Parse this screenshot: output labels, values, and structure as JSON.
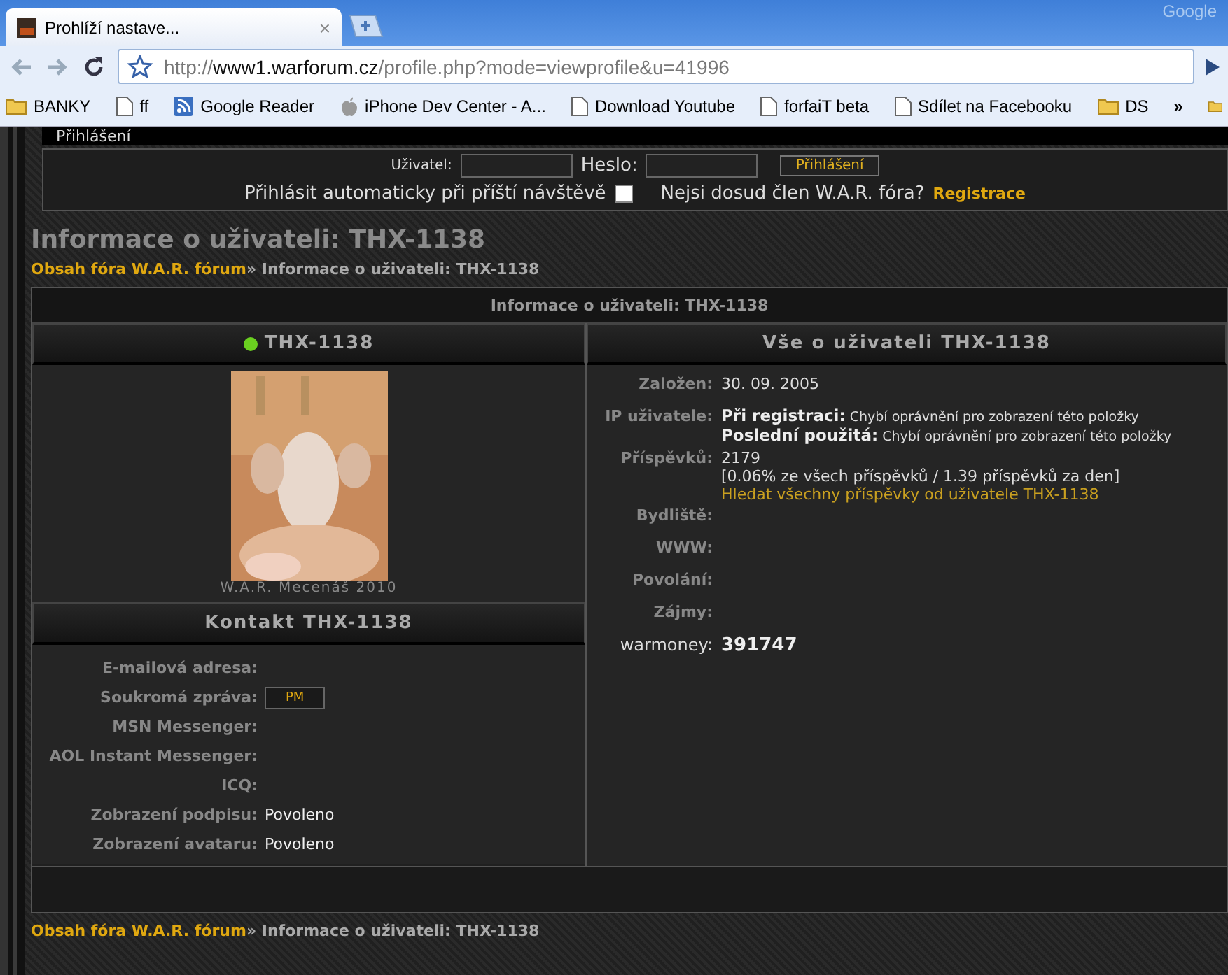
{
  "browser": {
    "tab_title": "Prohlíží nastave...",
    "tab_close": "×",
    "corner_text": "Google",
    "url": {
      "scheme": "http://",
      "host": "www1.warforum.cz",
      "path": "/profile.php?mode=viewprofile&u=41996"
    },
    "bookmarks": [
      {
        "label": "BANKY",
        "kind": "folder"
      },
      {
        "label": "ff",
        "kind": "page"
      },
      {
        "label": "Google Reader",
        "kind": "feed"
      },
      {
        "label": "iPhone Dev Center - A...",
        "kind": "apple"
      },
      {
        "label": "Download Youtube",
        "kind": "page"
      },
      {
        "label": "forfaiT beta",
        "kind": "page"
      },
      {
        "label": "Sdílet na Facebooku",
        "kind": "page"
      },
      {
        "label": "DS",
        "kind": "folder"
      }
    ],
    "overflow": "»"
  },
  "login": {
    "heading": "Přihlášení",
    "user_label": "Uživatel:",
    "password_label": "Heslo:",
    "button": "Přihlášení",
    "autologin_label": "Přihlásit automaticky při příští návštěvě",
    "autologin_checked": false,
    "register_prompt": "Nejsi dosud člen W.A.R. fóra?",
    "register_link": "Registrace"
  },
  "page_title": "Informace o uživateli: THX-1138",
  "breadcrumb": {
    "home": "Obsah fóra W.A.R. fórum",
    "separator": "»",
    "current": "Informace o uživateli: THX-1138"
  },
  "panel_title": "Informace o uživateli: THX-1138",
  "profile": {
    "username": "THX-1138",
    "online": true,
    "rank": "W.A.R. Mecenáš 2010"
  },
  "contact": {
    "title": "Kontakt THX-1138",
    "rows": [
      {
        "label": "E-mailová adresa:",
        "kind": "empty"
      },
      {
        "label": "Soukromá zpráva:",
        "kind": "button",
        "value": "PM"
      },
      {
        "label": "MSN Messenger:",
        "kind": "empty"
      },
      {
        "label": "AOL Instant Messenger:",
        "kind": "empty"
      },
      {
        "label": "ICQ:",
        "kind": "empty"
      },
      {
        "label": "Zobrazení podpisu:",
        "kind": "text",
        "value": "Povoleno"
      },
      {
        "label": "Zobrazení avataru:",
        "kind": "text",
        "value": "Povoleno"
      }
    ]
  },
  "about": {
    "title": "Vše o uživateli THX-1138",
    "rows": [
      {
        "label": "Založen:",
        "kind": "text",
        "lines": [
          "30. 09. 2005"
        ]
      },
      {
        "label": "IP uživatele:",
        "kind": "rich",
        "lines": [
          "**Při registraci:** Chybí oprávnění pro zobrazení této položky",
          "**Poslední použitá:** Chybí oprávnění pro zobrazení této položky"
        ]
      },
      {
        "label": "Příspěvků:",
        "kind": "posts",
        "lines": [
          "2179",
          "[0.06% ze všech příspěvků / 1.39 příspěvků za den]"
        ],
        "link": "Hledat všechny příspěvky od uživatele THX-1138"
      },
      {
        "label": "Bydliště:",
        "kind": "empty"
      },
      {
        "label": "WWW:",
        "kind": "empty"
      },
      {
        "label": "Povolání:",
        "kind": "empty"
      },
      {
        "label": "Zájmy:",
        "kind": "empty"
      },
      {
        "label": "warmoney:",
        "kind": "highlight",
        "lines": [
          "391747"
        ]
      }
    ]
  },
  "footer_breadcrumb": {
    "home": "Obsah fóra W.A.R. fórum",
    "separator": "»",
    "current": "Informace o uživateli: THX-1138"
  }
}
